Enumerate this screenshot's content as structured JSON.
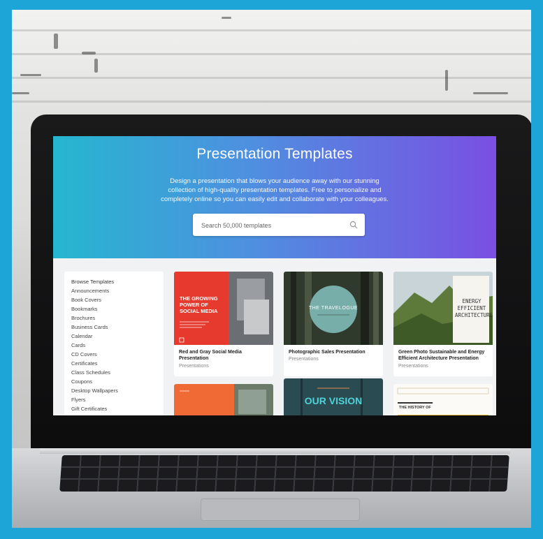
{
  "hero": {
    "title": "Presentation Templates",
    "description": "Design a presentation that blows your audience away with our stunning collection of high-quality presentation templates. Free to personalize and completely online so you can easily edit and collaborate with your colleagues."
  },
  "search": {
    "placeholder": "Search 50,000 templates",
    "value": ""
  },
  "sidebar": {
    "items": [
      "Browse Templates",
      "Announcements",
      "Book Covers",
      "Bookmarks",
      "Brochures",
      "Business Cards",
      "Calendar",
      "Cards",
      "CD Covers",
      "Certificates",
      "Class Schedules",
      "Coupons",
      "Desktop Wallpapers",
      "Flyers",
      "Gift Certificates"
    ]
  },
  "cards": [
    {
      "title": "Red and Gray Social Media Presentation",
      "subtitle": "Presentations",
      "thumb": {
        "headline": "THE GROWING POWER OF SOCIAL MEDIA",
        "accent": "#e63a2e"
      }
    },
    {
      "title": "Photographic Sales Presentation",
      "subtitle": "Presentations",
      "thumb": {
        "headline": "THE TRAVELOGUE",
        "accent": "#7fb9b4"
      }
    },
    {
      "title": "Green Photo Sustainable and Energy Efficient Architecture Presentation",
      "subtitle": "Presentations",
      "thumb": {
        "headline": "ENERGY EFFICIENT ARCHITECTURE",
        "accent": "#5e7a3a"
      }
    },
    {
      "thumb": {
        "accent": "#f06a35"
      }
    },
    {
      "thumb": {
        "headline": "OUR VISION",
        "accent": "#2a4b52"
      }
    },
    {
      "thumb": {
        "headline": "THE HISTORY OF",
        "accent": "#f4c23a"
      }
    }
  ]
}
